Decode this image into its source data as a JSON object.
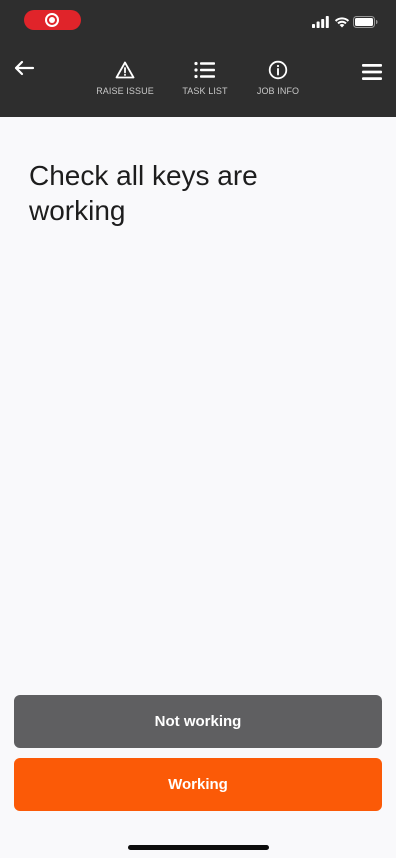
{
  "header": {
    "nav": [
      {
        "label": "RAISE ISSUE",
        "icon": "warning-triangle-icon"
      },
      {
        "label": "TASK LIST",
        "icon": "list-icon"
      },
      {
        "label": "JOB INFO",
        "icon": "info-icon"
      }
    ],
    "back_icon": "arrow-left-icon",
    "menu_icon": "hamburger-menu-icon"
  },
  "status_bar": {
    "indicators": [
      "screen-recording-icon",
      "cellular-signal-icon",
      "wifi-icon",
      "battery-icon"
    ]
  },
  "main": {
    "title": "Check all keys are working"
  },
  "actions": {
    "not_working_label": "Not working",
    "working_label": "Working"
  },
  "colors": {
    "header_bg": "#2e2e2e",
    "page_bg": "#f9f9fb",
    "recording_red": "#e0242a",
    "not_working_bg": "#5f5f61",
    "working_bg": "#fb5a07",
    "nav_label": "#c8c8c8",
    "title_text": "#1d1d1d"
  }
}
